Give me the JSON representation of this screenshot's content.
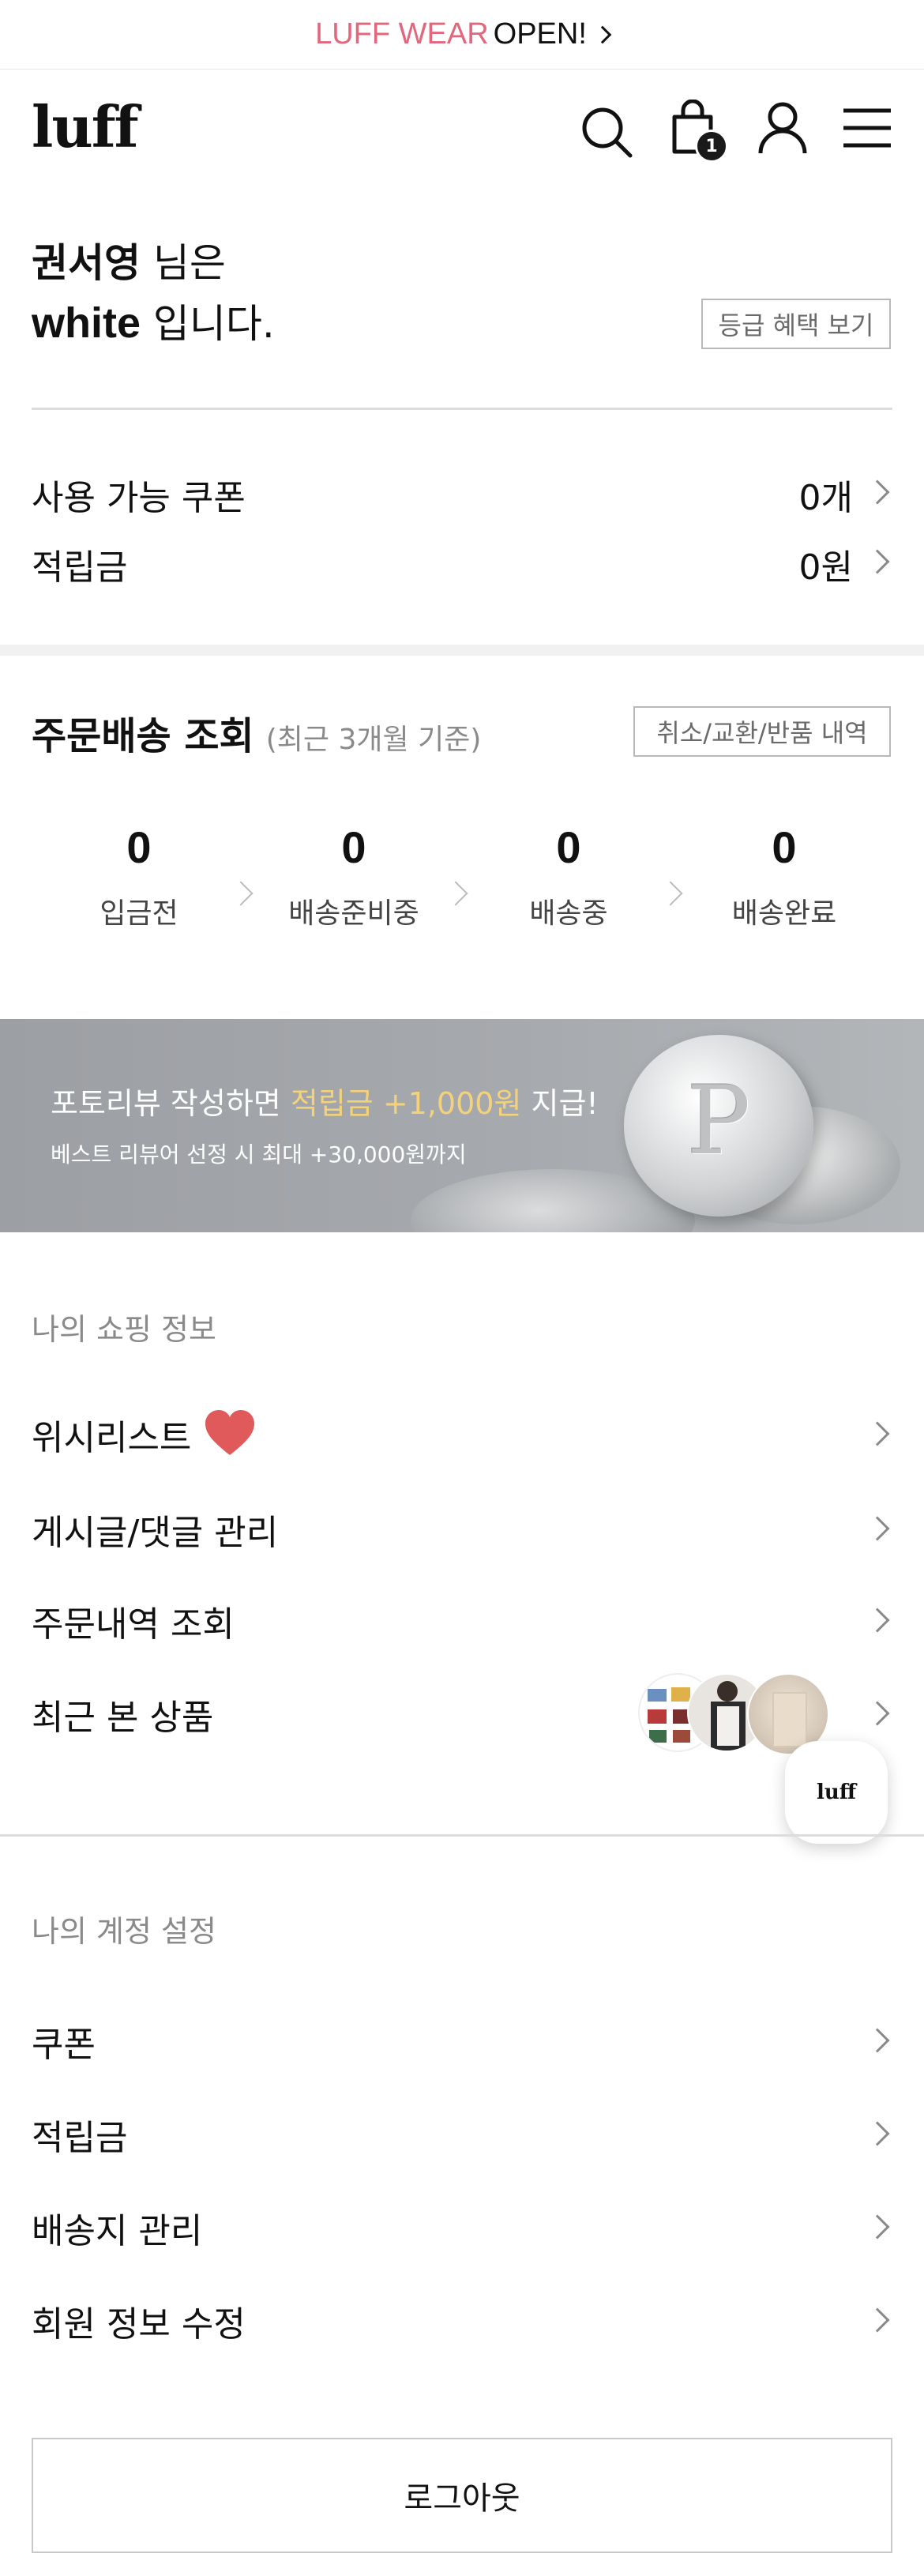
{
  "top_banner": {
    "brand": "LUFF WEAR",
    "status": "OPEN!",
    "brand_color": "#e2677d"
  },
  "header": {
    "logo": "luff",
    "cart_count": "1"
  },
  "member": {
    "name": "권서영",
    "name_suffix": "님은",
    "grade": "white",
    "grade_suffix": "입니다.",
    "benefit_button": "등급 혜택 보기"
  },
  "points": [
    {
      "label": "사용 가능 쿠폰",
      "value": "0개"
    },
    {
      "label": "적립금",
      "value": "0원"
    }
  ],
  "orders": {
    "title": "주문배송 조회",
    "subtitle": "(최근 3개월 기준)",
    "history_button": "취소/교환/반품 내역",
    "steps": [
      {
        "count": "0",
        "label": "입금전"
      },
      {
        "count": "0",
        "label": "배송준비중"
      },
      {
        "count": "0",
        "label": "배송중"
      },
      {
        "count": "0",
        "label": "배송완료"
      }
    ]
  },
  "promo": {
    "text_before": "포토리뷰 작성하면",
    "highlight": "적립금 +1,000원",
    "text_after": "지급!",
    "subtext": "베스트 리뷰어 선정 시 최대 +30,000원까지",
    "highlight_color": "#f3d27a",
    "coin_letter": "P"
  },
  "shopping": {
    "title": "나의 쇼핑 정보",
    "items": [
      {
        "label": "위시리스트"
      },
      {
        "label": "게시글/댓글 관리"
      },
      {
        "label": "주문내역 조회"
      },
      {
        "label": "최근 본 상품"
      }
    ]
  },
  "floating_badge": "luff",
  "account": {
    "title": "나의 계정 설정",
    "items": [
      {
        "label": "쿠폰"
      },
      {
        "label": "적립금"
      },
      {
        "label": "배송지 관리"
      },
      {
        "label": "회원 정보 수정"
      }
    ]
  },
  "logout": "로그아웃"
}
